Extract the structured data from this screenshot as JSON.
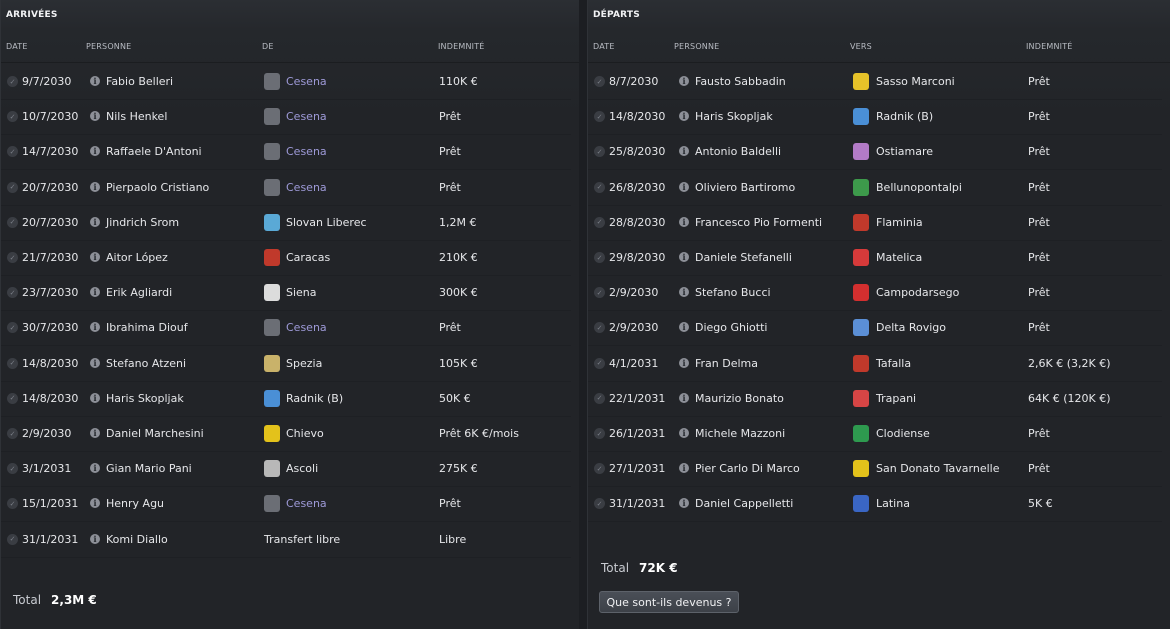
{
  "arrivals": {
    "title": "ARRIVÉES",
    "headers": {
      "date": "DATE",
      "person": "PERSONNE",
      "club": "DE",
      "fee": "INDEMNITÉ"
    },
    "rows": [
      {
        "date": "9/7/2030",
        "person": "Fabio Belleri",
        "club": "Cesena",
        "fee": "110K €",
        "crest": "#6b6e75",
        "link": true
      },
      {
        "date": "10/7/2030",
        "person": "Nils Henkel",
        "club": "Cesena",
        "fee": "Prêt",
        "crest": "#6b6e75",
        "link": true
      },
      {
        "date": "14/7/2030",
        "person": "Raffaele D'Antoni",
        "club": "Cesena",
        "fee": "Prêt",
        "crest": "#6b6e75",
        "link": true
      },
      {
        "date": "20/7/2030",
        "person": "Pierpaolo Cristiano",
        "club": "Cesena",
        "fee": "Prêt",
        "crest": "#6b6e75",
        "link": true
      },
      {
        "date": "20/7/2030",
        "person": "Jindrich Srom",
        "club": "Slovan Liberec",
        "fee": "1,2M €",
        "crest": "#5aa9d6",
        "link": false
      },
      {
        "date": "21/7/2030",
        "person": "Aitor López",
        "club": "Caracas",
        "fee": "210K €",
        "crest": "#c0392b",
        "link": false
      },
      {
        "date": "23/7/2030",
        "person": "Erik Agliardi",
        "club": "Siena",
        "fee": "300K €",
        "crest": "#dcdcdc",
        "link": false
      },
      {
        "date": "30/7/2030",
        "person": "Ibrahima Diouf",
        "club": "Cesena",
        "fee": "Prêt",
        "crest": "#6b6e75",
        "link": true
      },
      {
        "date": "14/8/2030",
        "person": "Stefano Atzeni",
        "club": "Spezia",
        "fee": "105K €",
        "crest": "#c9b26a",
        "link": false
      },
      {
        "date": "14/8/2030",
        "person": "Haris Skopljak",
        "club": "Radnik (B)",
        "fee": "50K €",
        "crest": "#4a8fd6",
        "link": false
      },
      {
        "date": "2/9/2030",
        "person": "Daniel Marchesini",
        "club": "Chievo",
        "fee": "Prêt 6K €/mois",
        "crest": "#e3c21b",
        "link": false
      },
      {
        "date": "3/1/2031",
        "person": "Gian Mario Pani",
        "club": "Ascoli",
        "fee": "275K €",
        "crest": "#b8b8b8",
        "link": false
      },
      {
        "date": "15/1/2031",
        "person": "Henry Agu",
        "club": "Cesena",
        "fee": "Prêt",
        "crest": "#6b6e75",
        "link": true
      },
      {
        "date": "31/1/2031",
        "person": "Komi Diallo",
        "club": "Transfert libre",
        "fee": "Libre",
        "crest": "",
        "link": false
      }
    ],
    "total_label": "Total",
    "total_value": "2,3M €"
  },
  "departures": {
    "title": "DÉPARTS",
    "headers": {
      "date": "DATE",
      "person": "PERSONNE",
      "club": "VERS",
      "fee": "INDEMNITÉ"
    },
    "rows": [
      {
        "date": "8/7/2030",
        "person": "Fausto Sabbadin",
        "club": "Sasso Marconi",
        "fee": "Prêt",
        "crest": "#e6c229"
      },
      {
        "date": "14/8/2030",
        "person": "Haris Skopljak",
        "club": "Radnik (B)",
        "fee": "Prêt",
        "crest": "#4a8fd6"
      },
      {
        "date": "25/8/2030",
        "person": "Antonio Baldelli",
        "club": "Ostiamare",
        "fee": "Prêt",
        "crest": "#b37bc7"
      },
      {
        "date": "26/8/2030",
        "person": "Oliviero Bartiromo",
        "club": "Bellunopontalpi",
        "fee": "Prêt",
        "crest": "#3d9a4b"
      },
      {
        "date": "28/8/2030",
        "person": "Francesco Pio Formenti",
        "club": "Flaminia",
        "fee": "Prêt",
        "crest": "#c0392b"
      },
      {
        "date": "29/8/2030",
        "person": "Daniele Stefanelli",
        "club": "Matelica",
        "fee": "Prêt",
        "crest": "#d63a3a"
      },
      {
        "date": "2/9/2030",
        "person": "Stefano Bucci",
        "club": "Campodarsego",
        "fee": "Prêt",
        "crest": "#d32f2f"
      },
      {
        "date": "2/9/2030",
        "person": "Diego Ghiotti",
        "club": "Delta Rovigo",
        "fee": "Prêt",
        "crest": "#5b8fd6"
      },
      {
        "date": "4/1/2031",
        "person": "Fran Delma",
        "club": "Tafalla",
        "fee": "2,6K € (3,2K €)",
        "crest": "#c0392b"
      },
      {
        "date": "22/1/2031",
        "person": "Maurizio Bonato",
        "club": "Trapani",
        "fee": "64K € (120K €)",
        "crest": "#d64545"
      },
      {
        "date": "26/1/2031",
        "person": "Michele Mazzoni",
        "club": "Clodiense",
        "fee": "Prêt",
        "crest": "#2e9a4f"
      },
      {
        "date": "27/1/2031",
        "person": "Pier Carlo Di Marco",
        "club": "San Donato Tavarnelle",
        "fee": "Prêt",
        "crest": "#e3c21b"
      },
      {
        "date": "31/1/2031",
        "person": "Daniel Cappelletti",
        "club": "Latina",
        "fee": "5K €",
        "crest": "#3a66c4"
      }
    ],
    "total_label": "Total",
    "total_value": "72K €"
  },
  "button": {
    "label": "Que sont-ils devenus ?"
  }
}
